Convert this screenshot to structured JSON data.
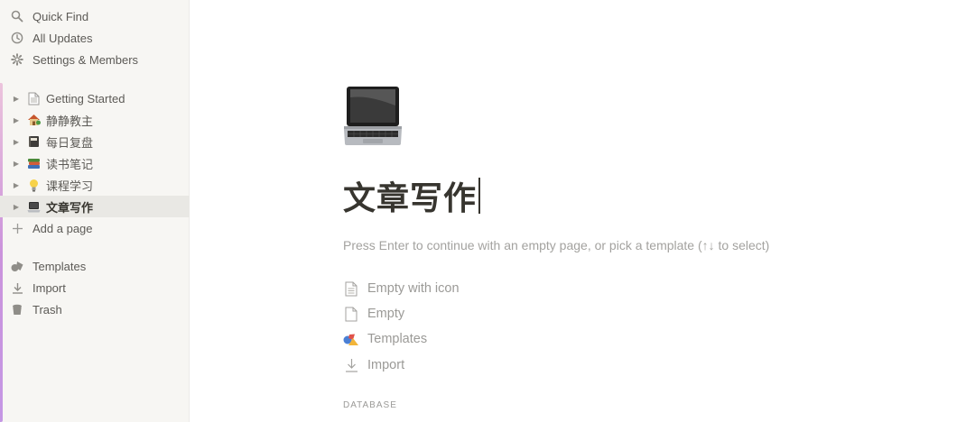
{
  "sidebar": {
    "top_items": [
      {
        "label": "Quick Find",
        "icon": "search-icon"
      },
      {
        "label": "All Updates",
        "icon": "clock-icon"
      },
      {
        "label": "Settings & Members",
        "icon": "gear-icon"
      }
    ],
    "pages": [
      {
        "label": "Getting Started",
        "emoji": "📄"
      },
      {
        "label": "静静教主",
        "emoji": "🏡"
      },
      {
        "label": "每日复盘",
        "emoji": "📓"
      },
      {
        "label": "读书笔记",
        "emoji": "📚"
      },
      {
        "label": "课程学习",
        "emoji": "💡"
      },
      {
        "label": "文章写作",
        "emoji": "💻"
      }
    ],
    "add_page_label": "Add a page",
    "bottom_items": [
      {
        "label": "Templates",
        "icon": "templates-icon"
      },
      {
        "label": "Import",
        "icon": "import-icon"
      },
      {
        "label": "Trash",
        "icon": "trash-icon"
      }
    ]
  },
  "main": {
    "page_icon": "laptop-icon",
    "title": "文章写作",
    "hint": "Press Enter to continue with an empty page, or pick a template (↑↓ to select)",
    "options": [
      {
        "label": "Empty with icon",
        "icon": "page-with-icon-icon"
      },
      {
        "label": "Empty",
        "icon": "empty-page-icon"
      },
      {
        "label": "Templates",
        "icon": "templates-icon"
      },
      {
        "label": "Import",
        "icon": "import-icon"
      }
    ],
    "section_label": "DATABASE"
  }
}
